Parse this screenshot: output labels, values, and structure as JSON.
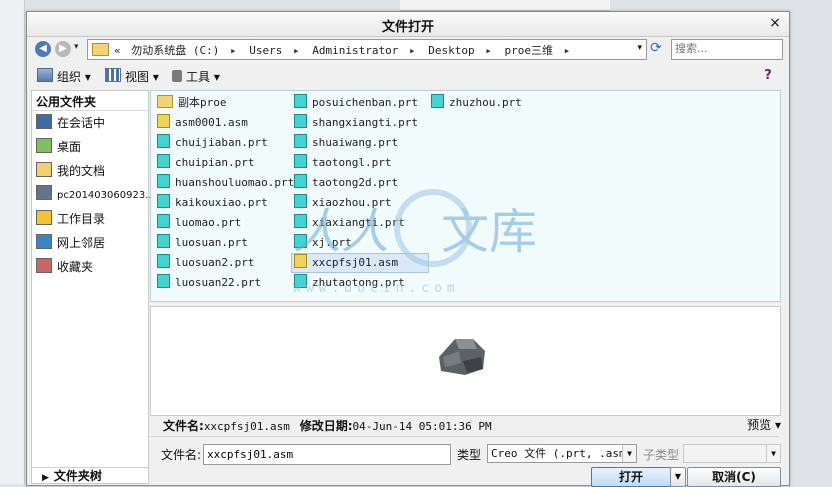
{
  "window": {
    "title": "文件打开",
    "close_glyph": "×"
  },
  "address_bar": {
    "segments": [
      "«",
      "勿动系统盘 (C:)",
      "Users",
      "Administrator",
      "Desktop",
      "proe三维"
    ],
    "separator": "▸"
  },
  "search": {
    "placeholder": "搜索..."
  },
  "toolbar": {
    "organize": "组织",
    "view": "视图",
    "tools": "工具"
  },
  "sidebar": {
    "header": "公用文件夹",
    "items": [
      {
        "label": "在会话中",
        "icon": "session-icon"
      },
      {
        "label": "桌面",
        "icon": "desktop-icon"
      },
      {
        "label": "我的文档",
        "icon": "documents-icon"
      },
      {
        "label": "pc201403060923...",
        "icon": "computer-icon"
      },
      {
        "label": "工作目录",
        "icon": "working-dir-icon"
      },
      {
        "label": "网上邻居",
        "icon": "network-icon"
      },
      {
        "label": "收藏夹",
        "icon": "favorites-icon"
      }
    ],
    "folder_tree": "文件夹树"
  },
  "files": {
    "col1": [
      {
        "name": "副本proe",
        "type": "folder"
      },
      {
        "name": "asm0001.asm",
        "type": "asm"
      },
      {
        "name": "chuijiaban.prt",
        "type": "prt"
      },
      {
        "name": "chuipian.prt",
        "type": "prt"
      },
      {
        "name": "huanshouluomao.prt",
        "type": "prt"
      },
      {
        "name": "kaikouxiao.prt",
        "type": "prt"
      },
      {
        "name": "luomao.prt",
        "type": "prt"
      },
      {
        "name": "luosuan.prt",
        "type": "prt"
      },
      {
        "name": "luosuan2.prt",
        "type": "prt"
      },
      {
        "name": "luosuan22.prt",
        "type": "prt"
      }
    ],
    "col2": [
      {
        "name": "posuichenban.prt",
        "type": "prt"
      },
      {
        "name": "shangxiangti.prt",
        "type": "prt"
      },
      {
        "name": "shuaiwang.prt",
        "type": "prt"
      },
      {
        "name": "taotongl.prt",
        "type": "prt"
      },
      {
        "name": "taotong2d.prt",
        "type": "prt"
      },
      {
        "name": "xiaozhou.prt",
        "type": "prt"
      },
      {
        "name": "xiaxiangti.prt",
        "type": "prt"
      },
      {
        "name": "xj.prt",
        "type": "prt"
      },
      {
        "name": "xxcpfsj01.asm",
        "type": "asm",
        "selected": true
      },
      {
        "name": "zhutaotong.prt",
        "type": "prt"
      }
    ],
    "col3": [
      {
        "name": "zhuzhou.prt",
        "type": "prt"
      }
    ]
  },
  "watermark": {
    "text": "文库",
    "url": "www.docin.com",
    "glyph": "人人"
  },
  "info": {
    "filename_label": "文件名:",
    "filename_value": "xxcpfsj01.asm",
    "modified_label": "修改日期:",
    "modified_value": "04-Jun-14 05:01:36 PM",
    "preview_toggle": "预览 ▾"
  },
  "form": {
    "filename_label": "文件名:",
    "filename_value": "xxcpfsj01.asm",
    "type_label": "类型",
    "type_value": "Creo 文件 (.prt, .asm)",
    "subtype_label": "子类型",
    "subtype_value": "",
    "open": "打开",
    "cancel": "取消(C)"
  },
  "colors": {
    "file_area_bg": "#f1fbfb",
    "prt_icon": "#44d3d3",
    "asm_icon": "#efd45c",
    "folder_icon": "#f3d27a"
  }
}
